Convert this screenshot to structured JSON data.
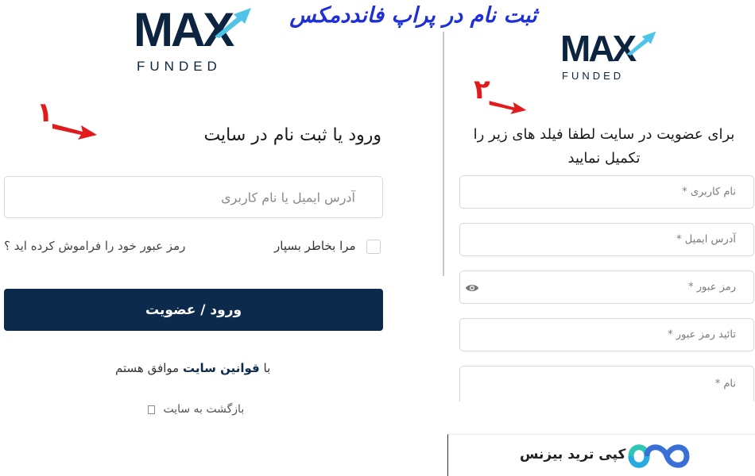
{
  "headline": "ثبت نام در پراپ فانددمکس",
  "logo": {
    "mark": "MAX",
    "sub": "FUNDED"
  },
  "steps": {
    "one": "۱",
    "two": "۲"
  },
  "login": {
    "title": "ورود یا ثبت نام در سایت",
    "field_placeholder": "آدرس ایمیل یا نام کاربری",
    "remember_label": "مرا بخاطر بسپار",
    "forgot_label": "رمز عبور خود را فراموش کرده اید ؟",
    "submit_label": "ورود / عضویت",
    "terms_prefix": "با",
    "terms_link": "قوانین سایت",
    "terms_suffix": "موافق هستم",
    "back_label": "بازگشت به سایت"
  },
  "register": {
    "title": "برای عضویت در سایت لطفا فیلد های زیر را تکمیل نمایید",
    "fields": {
      "username": "نام کاربری *",
      "email": "آدرس ایمیل *",
      "password": "رمز عبور *",
      "confirm": "تائید رمز عبور *",
      "name": "نام *"
    }
  },
  "brand": {
    "name": "کپی ترید بیزنس"
  },
  "colors": {
    "navy": "#0c2a4b",
    "accent": "#1f2fd6",
    "annotation": "#e11b1b",
    "logo_sky": "#4fc3e8"
  },
  "icons": {
    "eye": "eye-icon",
    "back": "square-icon",
    "brand": "infinity-logo"
  }
}
